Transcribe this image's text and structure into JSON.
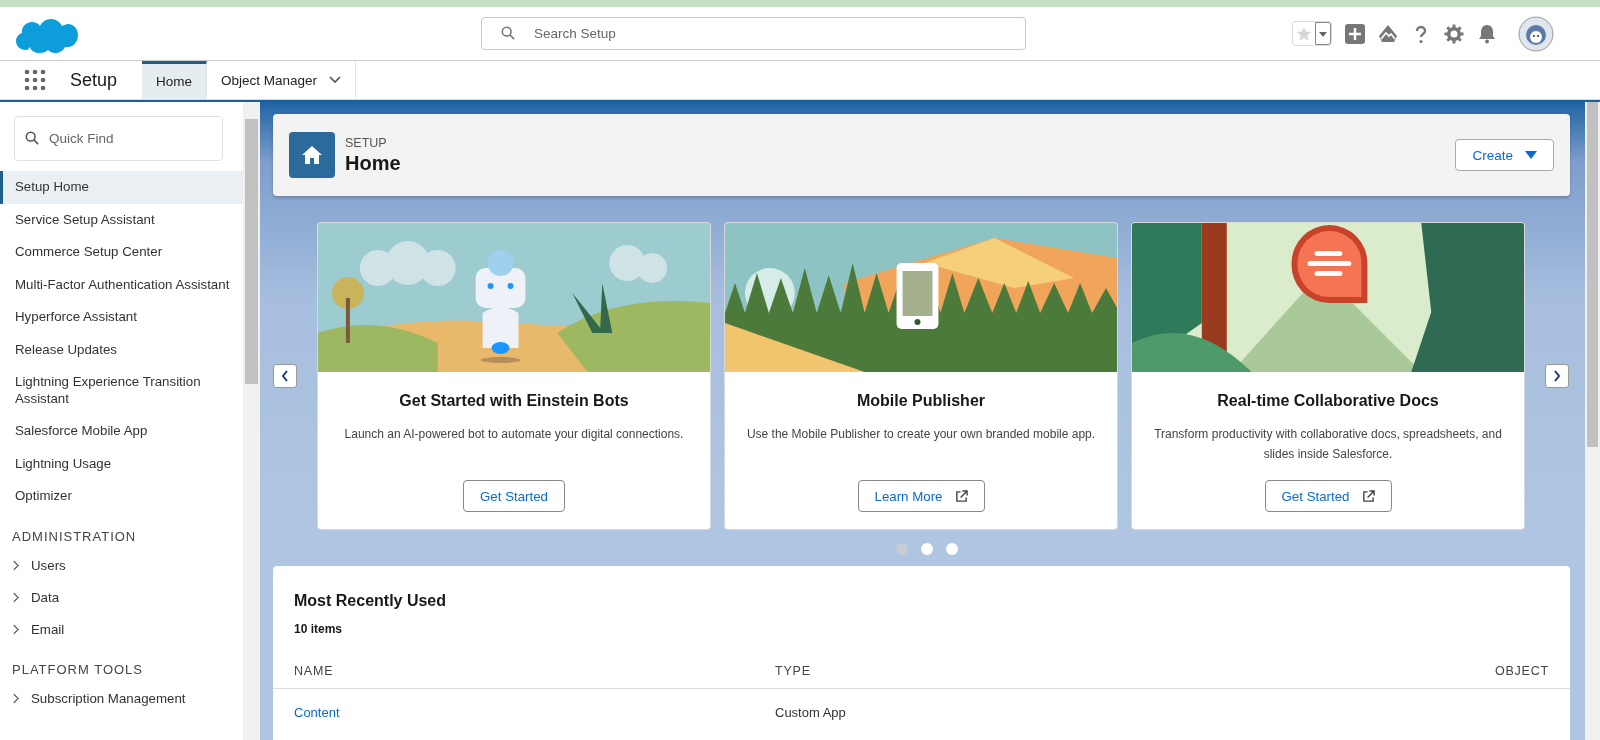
{
  "header": {
    "search": {
      "placeholder": "Search Setup"
    }
  },
  "nav": {
    "app_name": "Setup",
    "tabs": [
      {
        "label": "Home",
        "selected": true,
        "kind": "plain"
      },
      {
        "label": "Object Manager",
        "selected": false,
        "kind": "dropdown"
      }
    ]
  },
  "sidebar": {
    "quick_find": {
      "placeholder": "Quick Find"
    },
    "items": [
      {
        "label": "Setup Home",
        "selected": true
      },
      {
        "label": "Service Setup Assistant",
        "selected": false
      },
      {
        "label": "Commerce Setup Center",
        "selected": false
      },
      {
        "label": "Multi-Factor Authentication Assistant",
        "selected": false
      },
      {
        "label": "Hyperforce Assistant",
        "selected": false
      },
      {
        "label": "Release Updates",
        "selected": false
      },
      {
        "label": "Lightning Experience Transition Assistant",
        "selected": false
      },
      {
        "label": "Salesforce Mobile App",
        "selected": false
      },
      {
        "label": "Lightning Usage",
        "selected": false
      },
      {
        "label": "Optimizer",
        "selected": false
      }
    ],
    "sections": [
      {
        "title": "ADMINISTRATION",
        "items": [
          {
            "label": "Users",
            "expanded": false
          },
          {
            "label": "Data",
            "expanded": false
          },
          {
            "label": "Email",
            "expanded": false
          }
        ]
      },
      {
        "title": "PLATFORM TOOLS",
        "items": [
          {
            "label": "Subscription Management",
            "expanded": false
          }
        ]
      }
    ]
  },
  "page_header": {
    "eyebrow": "SETUP",
    "title": "Home",
    "button": "Create"
  },
  "carousel": {
    "cards": [
      {
        "title": "Get Started with Einstein Bots",
        "description": "Launch an AI-powered bot to automate your digital connections.",
        "button": "Get Started",
        "external": false
      },
      {
        "title": "Mobile Publisher",
        "description": "Use the Mobile Publisher to create your own branded mobile app.",
        "button": "Learn More",
        "external": true
      },
      {
        "title": "Real-time Collaborative Docs",
        "description": "Transform productivity with collaborative docs, spreadsheets, and slides inside Salesforce.",
        "button": "Get Started",
        "external": true
      }
    ],
    "dots": [
      {
        "selected": true
      },
      {
        "selected": false
      },
      {
        "selected": false
      }
    ]
  },
  "recent": {
    "title": "Most Recently Used",
    "count": "10 items",
    "columns": [
      "NAME",
      "TYPE",
      "OBJECT"
    ],
    "rows": [
      {
        "name": "Content",
        "type": "Custom App"
      }
    ]
  }
}
